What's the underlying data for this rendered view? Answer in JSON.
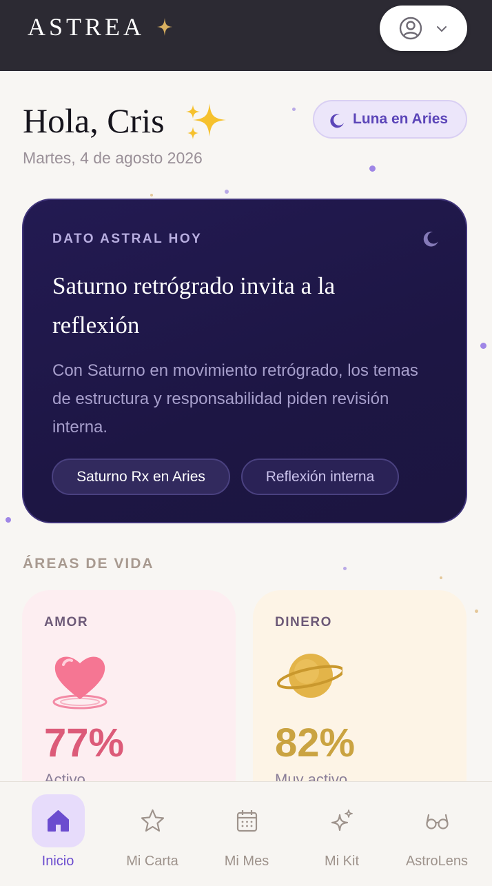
{
  "app": {
    "brand": "ASTREA"
  },
  "header": {
    "account_icon": "user-circle-icon",
    "menu_icon": "chevron-down-icon"
  },
  "greeting": {
    "text": "Hola, Cris",
    "date": "Martes, 4 de agosto 2026"
  },
  "moon_pill": {
    "label": "Luna en Aries",
    "icon": "moon-icon"
  },
  "astral_card": {
    "label": "DATO ASTRAL HOY",
    "title": "Saturno retrógrado invita a la reflexión",
    "body": "Con Saturno en movimiento retrógrado, los temas de estructura y responsabilidad piden revisión interna.",
    "chips": [
      "Saturno Rx en Aries",
      "Reflexión interna"
    ]
  },
  "areas": {
    "title": "ÁREAS DE VIDA",
    "items": [
      {
        "label": "AMOR",
        "percent": "77%",
        "status": "Activo",
        "icon": "heart-icon",
        "color": "#dc5b79"
      },
      {
        "label": "DINERO",
        "percent": "82%",
        "status": "Muy activo",
        "icon": "planet-icon",
        "color": "#caa341"
      }
    ]
  },
  "nav": {
    "items": [
      {
        "label": "Inicio",
        "icon": "home-icon",
        "active": true
      },
      {
        "label": "Mi Carta",
        "icon": "star-icon",
        "active": false
      },
      {
        "label": "Mi Mes",
        "icon": "calendar-icon",
        "active": false
      },
      {
        "label": "Mi Kit",
        "icon": "sparkles-icon",
        "active": false
      },
      {
        "label": "AstroLens",
        "icon": "glasses-icon",
        "active": false
      }
    ]
  },
  "colors": {
    "accent": "#6b4ccf",
    "header_bg": "#2c2a33",
    "card_bg": "#1d1644"
  }
}
